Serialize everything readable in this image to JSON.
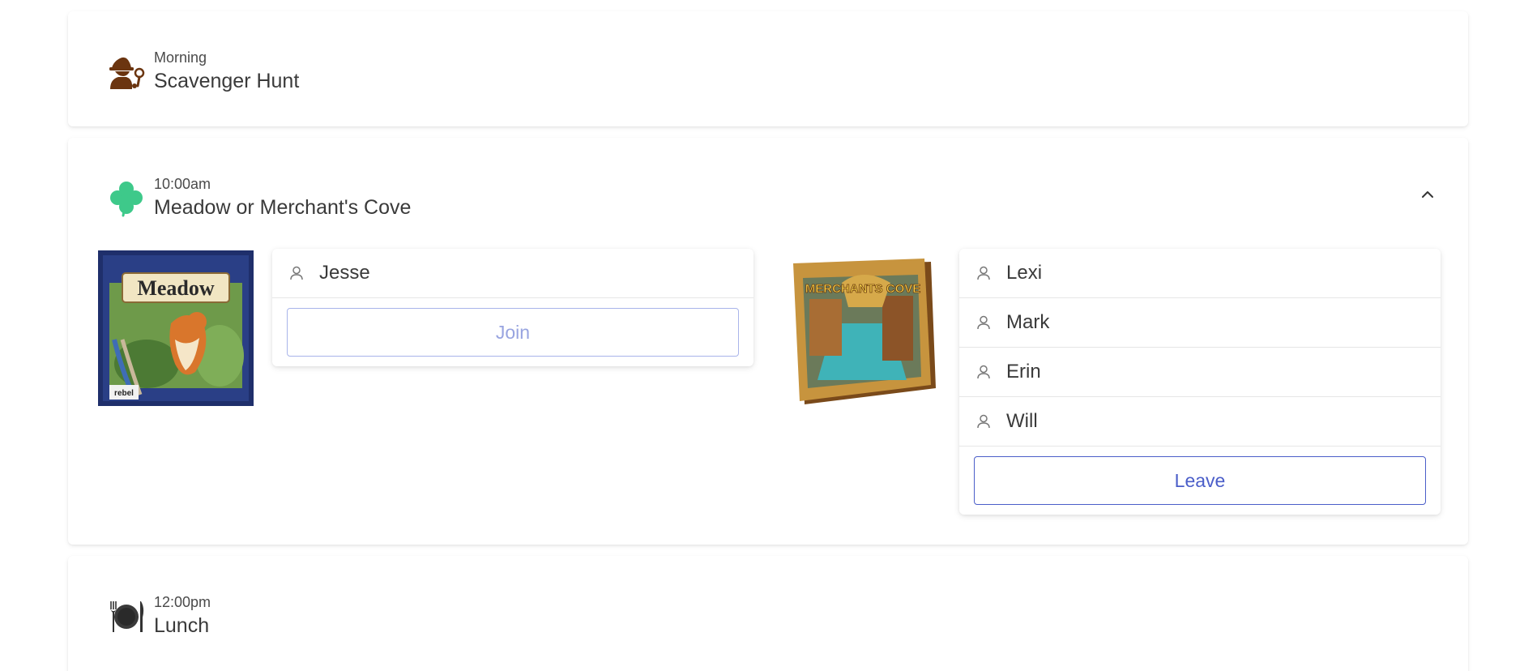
{
  "events": [
    {
      "time": "Morning",
      "title": "Scavenger Hunt",
      "icon": "detective-icon",
      "icon_color": "#6b3510"
    },
    {
      "time": "10:00am",
      "title": "Meadow or Merchant's Cove",
      "icon": "clover-icon",
      "icon_color": "#3ec98a",
      "expanded": true,
      "games": [
        {
          "name": "Meadow",
          "cover_text": "Meadow",
          "cover_publisher": "rebel",
          "players": [
            "Jesse"
          ],
          "button_label": "Join"
        },
        {
          "name": "Merchant's Cove",
          "cover_text": "MERCHANTS COVE",
          "players": [
            "Lexi",
            "Mark",
            "Erin",
            "Will"
          ],
          "button_label": "Leave"
        }
      ]
    },
    {
      "time": "12:00pm",
      "title": "Lunch",
      "icon": "plate-cutlery-icon",
      "icon_color": "#333333"
    }
  ],
  "colors": {
    "accent": "#4b5ec9",
    "accent_light": "#98a4e0",
    "card_bg": "#ffffff",
    "text": "#3a3a3a"
  }
}
